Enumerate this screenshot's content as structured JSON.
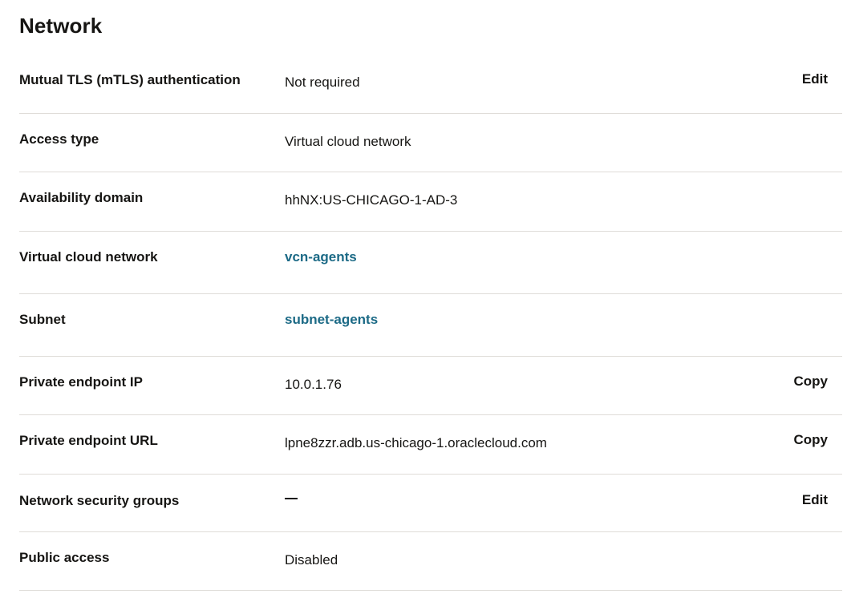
{
  "section": {
    "title": "Network"
  },
  "rows": [
    {
      "label": "Mutual TLS (mTLS) authentication",
      "value": "Not required",
      "action": "Edit"
    },
    {
      "label": "Access type",
      "value": "Virtual cloud network"
    },
    {
      "label": "Availability domain",
      "value": "hhNX:US-CHICAGO-1-AD-3"
    },
    {
      "label": "Virtual cloud network",
      "value": "vcn-agents"
    },
    {
      "label": "Subnet",
      "value": "subnet-agents"
    },
    {
      "label": "Private endpoint IP",
      "value": "10.0.1.76",
      "action": "Copy"
    },
    {
      "label": "Private endpoint URL",
      "value": "lpne8zzr.adb.us-chicago-1.oraclecloud.com",
      "action": "Copy"
    },
    {
      "label": "Network security groups",
      "value": "—",
      "action": "Edit"
    },
    {
      "label": "Public access",
      "value": "Disabled"
    }
  ],
  "colors": {
    "link": "#1c6a86",
    "text": "#161513",
    "divider": "#dfdcd8"
  }
}
